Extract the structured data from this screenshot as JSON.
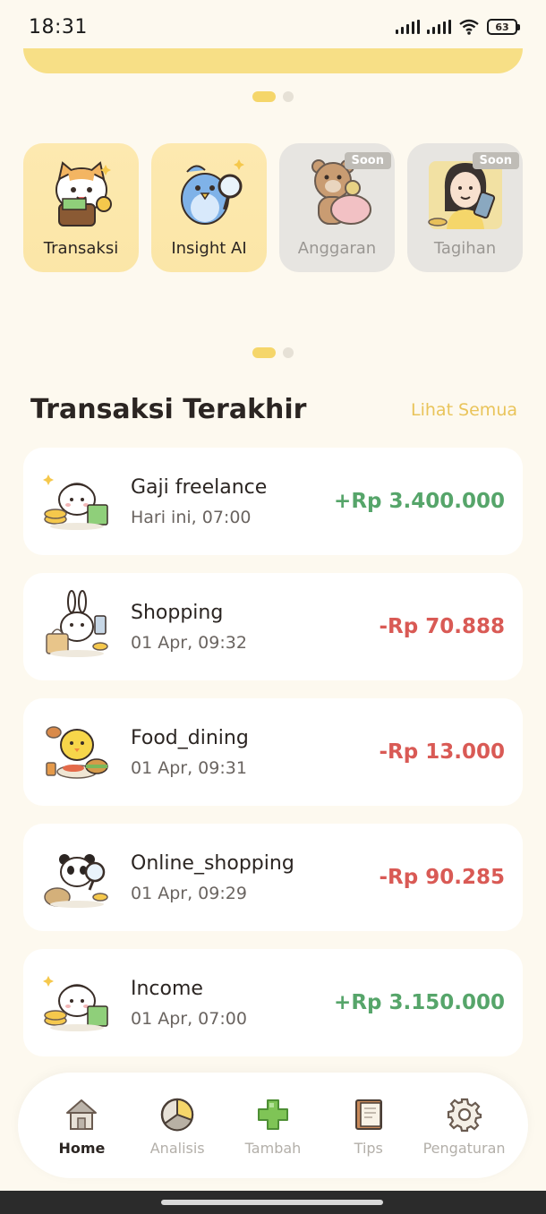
{
  "status_bar": {
    "time": "18:31",
    "battery": "63"
  },
  "features": [
    {
      "label": "Transaksi",
      "icon": "cat-wallet-icon",
      "disabled": false
    },
    {
      "label": "Insight AI",
      "icon": "bird-magnifier-icon",
      "disabled": false
    },
    {
      "label": "Anggaran",
      "icon": "bear-piggybank-icon",
      "disabled": true,
      "badge": "Soon"
    },
    {
      "label": "Tagihan",
      "icon": "woman-phone-icon",
      "disabled": true,
      "badge": "Soon"
    }
  ],
  "section": {
    "title": "Transaksi Terakhir",
    "see_all": "Lihat Semua"
  },
  "transactions": [
    {
      "title": "Gaji freelance",
      "date": "Hari ini, 07:00",
      "amount": "+Rp 3.400.000",
      "type": "income",
      "icon": "dumpling-money-icon"
    },
    {
      "title": "Shopping",
      "date": "01 Apr, 09:32",
      "amount": "-Rp 70.888",
      "type": "expense",
      "icon": "bunny-shopping-icon"
    },
    {
      "title": "Food_dining",
      "date": "01 Apr, 09:31",
      "amount": "-Rp 13.000",
      "type": "expense",
      "icon": "chick-food-icon"
    },
    {
      "title": "Online_shopping",
      "date": "01 Apr, 09:29",
      "amount": "-Rp 90.285",
      "type": "expense",
      "icon": "panda-search-icon"
    },
    {
      "title": "Income",
      "date": "01 Apr, 07:00",
      "amount": "+Rp 3.150.000",
      "type": "income",
      "icon": "dumpling-money-icon"
    }
  ],
  "nav": [
    {
      "label": "Home",
      "icon": "home-icon",
      "active": true
    },
    {
      "label": "Analisis",
      "icon": "pie-chart-icon",
      "active": false
    },
    {
      "label": "Tambah",
      "icon": "plus-icon",
      "active": false
    },
    {
      "label": "Tips",
      "icon": "book-icon",
      "active": false
    },
    {
      "label": "Pengaturan",
      "icon": "gear-icon",
      "active": false
    }
  ],
  "colors": {
    "background": "#fdf9ef",
    "accent": "#f5d66a",
    "income": "#56a56a",
    "expense": "#d95a55"
  }
}
